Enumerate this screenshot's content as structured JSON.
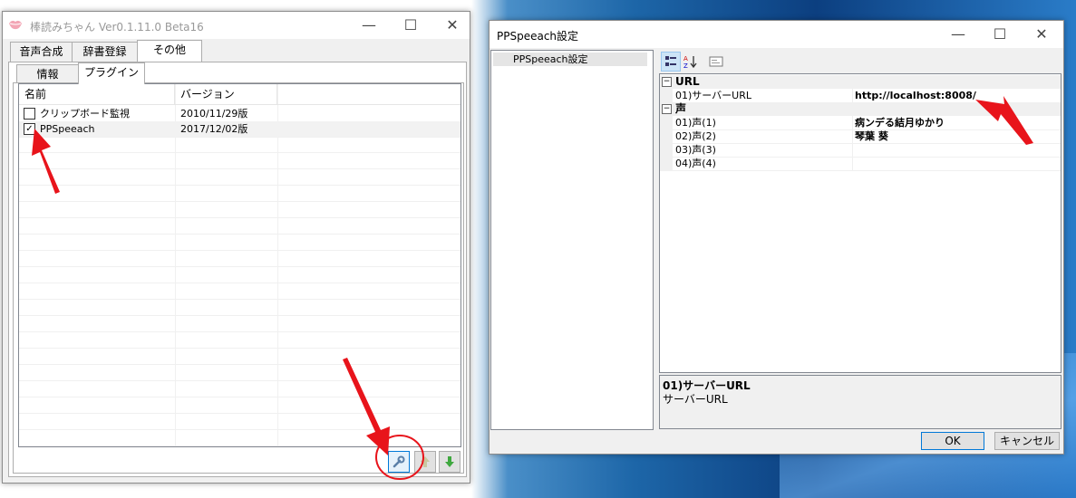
{
  "main_window": {
    "title": "棒読みちゃん Ver0.1.11.0 Beta16",
    "tabs": [
      "音声合成",
      "辞書登録",
      "その他"
    ],
    "subtabs": [
      "情報",
      "プラグイン"
    ],
    "list": {
      "columns": [
        "名前",
        "バージョン"
      ],
      "rows": [
        {
          "checked": false,
          "name": "クリップボード監視",
          "version": "2010/11/29版"
        },
        {
          "checked": true,
          "name": "PPSpeeach",
          "version": "2017/12/02版"
        }
      ]
    }
  },
  "settings_window": {
    "title": "PPSpeeach設定",
    "tree_item": "PPSpeeach設定",
    "categories": [
      {
        "label": "URL",
        "props": [
          {
            "name": "01)サーバーURL",
            "value": "http://localhost:8008/"
          }
        ]
      },
      {
        "label": "声",
        "props": [
          {
            "name": "01)声(1)",
            "value": "病ンデる結月ゆかり"
          },
          {
            "name": "02)声(2)",
            "value": "琴葉 葵"
          },
          {
            "name": "03)声(3)",
            "value": ""
          },
          {
            "name": "04)声(4)",
            "value": ""
          }
        ]
      }
    ],
    "description": {
      "title": "01)サーバーURL",
      "text": "サーバーURL"
    },
    "ok_label": "OK",
    "cancel_label": "キャンセル"
  },
  "colors": {
    "accent_red": "#e8141b",
    "selection_border": "#0078d7"
  }
}
